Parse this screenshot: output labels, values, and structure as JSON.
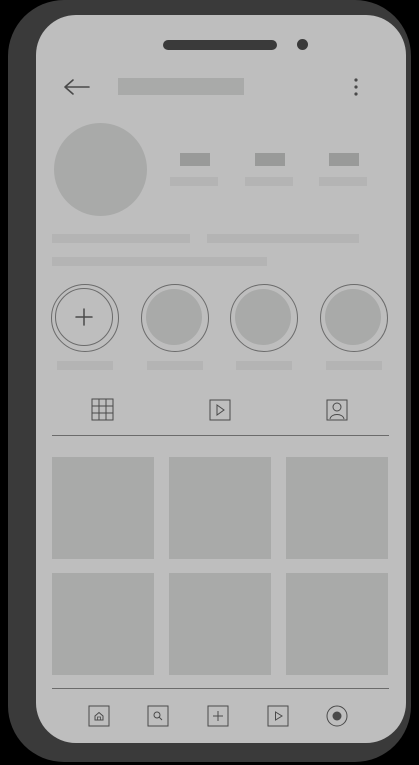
{
  "screen": {
    "header": {
      "back_icon": "arrow-left-icon",
      "title": "",
      "menu_icon": "kebab-vertical-icon"
    },
    "profile": {
      "avatar": "profile-avatar-placeholder",
      "stats": [
        {
          "name": "stat-posts"
        },
        {
          "name": "stat-followers"
        },
        {
          "name": "stat-following"
        }
      ]
    },
    "highlights": [
      {
        "name": "new",
        "icon": "plus-icon"
      },
      {
        "name": "highlight-1"
      },
      {
        "name": "highlight-2"
      },
      {
        "name": "highlight-3"
      }
    ],
    "tabs": [
      {
        "name": "grid",
        "icon": "grid-icon",
        "active": true
      },
      {
        "name": "reels",
        "icon": "play-icon"
      },
      {
        "name": "tagged",
        "icon": "person-tag-icon"
      }
    ],
    "grid": {
      "rows": 2,
      "columns": 3
    },
    "bottom_nav": [
      {
        "name": "home",
        "icon": "home-icon"
      },
      {
        "name": "search",
        "icon": "search-icon"
      },
      {
        "name": "create",
        "icon": "plus-square-icon"
      },
      {
        "name": "reels",
        "icon": "play-icon"
      },
      {
        "name": "profile",
        "icon": "profile-circle-icon"
      }
    ],
    "colors": {
      "frame": "#3a3a3a",
      "screen_bg": "#bebebe",
      "placeholder": "#a9aaa9",
      "line": "#6b6b6b"
    }
  }
}
